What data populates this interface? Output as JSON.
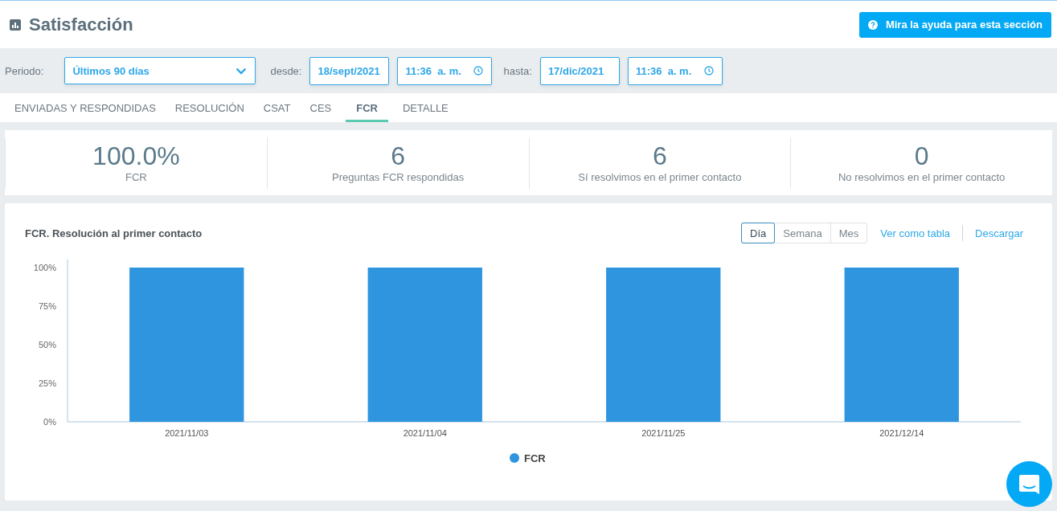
{
  "header": {
    "title": "Satisfacción",
    "help_button": "Mira la ayuda para esta sección"
  },
  "filters": {
    "period_label": "Periodo:",
    "period_value": "Últimos 90 días",
    "from_label": "desde:",
    "from_date": "18/sept/2021",
    "from_time": "11:36  a. m.",
    "to_label": "hasta:",
    "to_date": "17/dic/2021",
    "to_time": "11:36  a. m."
  },
  "tabs": [
    {
      "label": "ENVIADAS Y RESPONDIDAS",
      "selected": false
    },
    {
      "label": "RESOLUCIÓN",
      "selected": false
    },
    {
      "label": "CSAT",
      "selected": false
    },
    {
      "label": "CES",
      "selected": false
    },
    {
      "label": "FCR",
      "selected": true
    },
    {
      "label": "DETALLE",
      "selected": false
    }
  ],
  "stats": [
    {
      "value": "100.0%",
      "label": "FCR"
    },
    {
      "value": "6",
      "label": "Preguntas FCR respondidas"
    },
    {
      "value": "6",
      "label": "Sí resolvimos en el primer contacto"
    },
    {
      "value": "0",
      "label": "No resolvimos en el primer contacto"
    }
  ],
  "chart_panel": {
    "title": "FCR. Resolución al primer contacto",
    "granularity": [
      {
        "label": "Día",
        "selected": true
      },
      {
        "label": "Semana",
        "selected": false
      },
      {
        "label": "Mes",
        "selected": false
      }
    ],
    "links": [
      "Ver como tabla",
      "Descargar"
    ],
    "chart_data": {
      "type": "bar",
      "categories": [
        "2021/11/03",
        "2021/11/04",
        "2021/11/25",
        "2021/12/14"
      ],
      "series": [
        {
          "name": "FCR",
          "color": "#2e95de",
          "values": [
            100,
            100,
            100,
            100
          ]
        }
      ],
      "ylim": [
        0,
        100
      ],
      "yticks": [
        {
          "value": 0,
          "label": "0%"
        },
        {
          "value": 25,
          "label": "25%"
        },
        {
          "value": 50,
          "label": "50%"
        },
        {
          "value": 75,
          "label": "75%"
        },
        {
          "value": 100,
          "label": "100%"
        }
      ]
    }
  }
}
